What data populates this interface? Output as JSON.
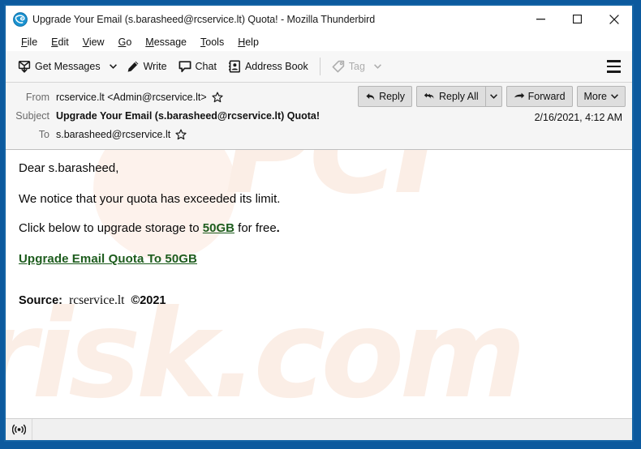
{
  "window": {
    "title": "Upgrade Your Email (s.barasheed@rcservice.lt) Quota! - Mozilla Thunderbird",
    "app_icon": "thunderbird-icon",
    "controls": {
      "minimize": "minimize-icon",
      "maximize": "maximize-icon",
      "close": "close-icon"
    },
    "border_color": "#1464a5"
  },
  "menubar": {
    "items": [
      {
        "accel": "F",
        "rest": "ile"
      },
      {
        "accel": "E",
        "rest": "dit"
      },
      {
        "accel": "V",
        "rest": "iew"
      },
      {
        "accel": "G",
        "rest": "o"
      },
      {
        "accel": "M",
        "rest": "essage"
      },
      {
        "accel": "T",
        "rest": "ools"
      },
      {
        "accel": "H",
        "rest": "elp"
      }
    ]
  },
  "toolbar": {
    "get_messages_label": "Get Messages",
    "write_label": "Write",
    "chat_label": "Chat",
    "address_book_label": "Address Book",
    "tag_label": "Tag",
    "app_menu": "hamburger-menu-icon"
  },
  "message_header": {
    "from_label": "From",
    "from_value": "rcservice.lt <Admin@rcservice.lt>",
    "subject_label": "Subject",
    "subject_value": "Upgrade Your Email (s.barasheed@rcservice.lt) Quota!",
    "to_label": "To",
    "to_value": "s.barasheed@rcservice.lt",
    "date": "2/16/2021, 4:12 AM",
    "actions": {
      "reply": "Reply",
      "reply_all": "Reply All",
      "forward": "Forward",
      "more": "More"
    }
  },
  "body": {
    "greeting": "Dear s.barasheed,",
    "line1": "We notice that your quota has exceeded its limit.",
    "line2_prefix": "Click below to upgrade storage to ",
    "line2_highlight": "50GB",
    "line2_suffix": " for free",
    "line2_period": ".",
    "cta_link": "Upgrade Email Quota To 50GB",
    "source_label": "Source:",
    "source_domain": "rcservice.lt",
    "source_copyright": "©2021",
    "link_color": "#1d5c1d",
    "watermark_line1": "PCI",
    "watermark_line2": "risk.com"
  },
  "statusbar": {
    "connection_icon": "broadcast-icon"
  }
}
